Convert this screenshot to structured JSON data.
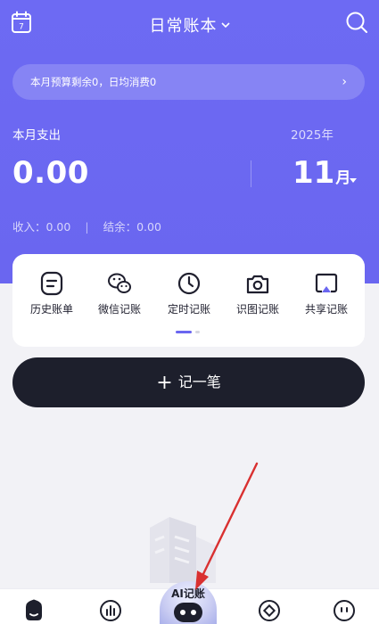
{
  "header": {
    "title": "日常账本",
    "calendar_icon_day": "7"
  },
  "budget": {
    "text": "本月预算剩余0，日均消费0",
    "arrow": "›"
  },
  "summary": {
    "expense_label": "本月支出",
    "expense_amount": "0.00",
    "year": "2025年",
    "month": "11",
    "month_unit": "月",
    "income": "收入：0.00",
    "separator": "|",
    "balance": "结余：0.00"
  },
  "quick_actions": [
    {
      "label": "历史账单",
      "icon": "history-bill-icon"
    },
    {
      "label": "微信记账",
      "icon": "wechat-icon"
    },
    {
      "label": "定时记账",
      "icon": "clock-icon"
    },
    {
      "label": "识图记账",
      "icon": "camera-icon"
    },
    {
      "label": "共享记账",
      "icon": "share-screen-icon"
    }
  ],
  "add_button": {
    "plus": "+",
    "label": "记一笔"
  },
  "bottom_nav": {
    "ai_label": "AI记账",
    "items": [
      "home-icon",
      "chart-icon",
      "ai-bot-icon",
      "discover-icon",
      "profile-icon"
    ]
  },
  "colors": {
    "accent": "#6a66f0",
    "dark": "#1d1f2c",
    "background": "#f2f2f6",
    "annotation_arrow": "#d93030"
  }
}
